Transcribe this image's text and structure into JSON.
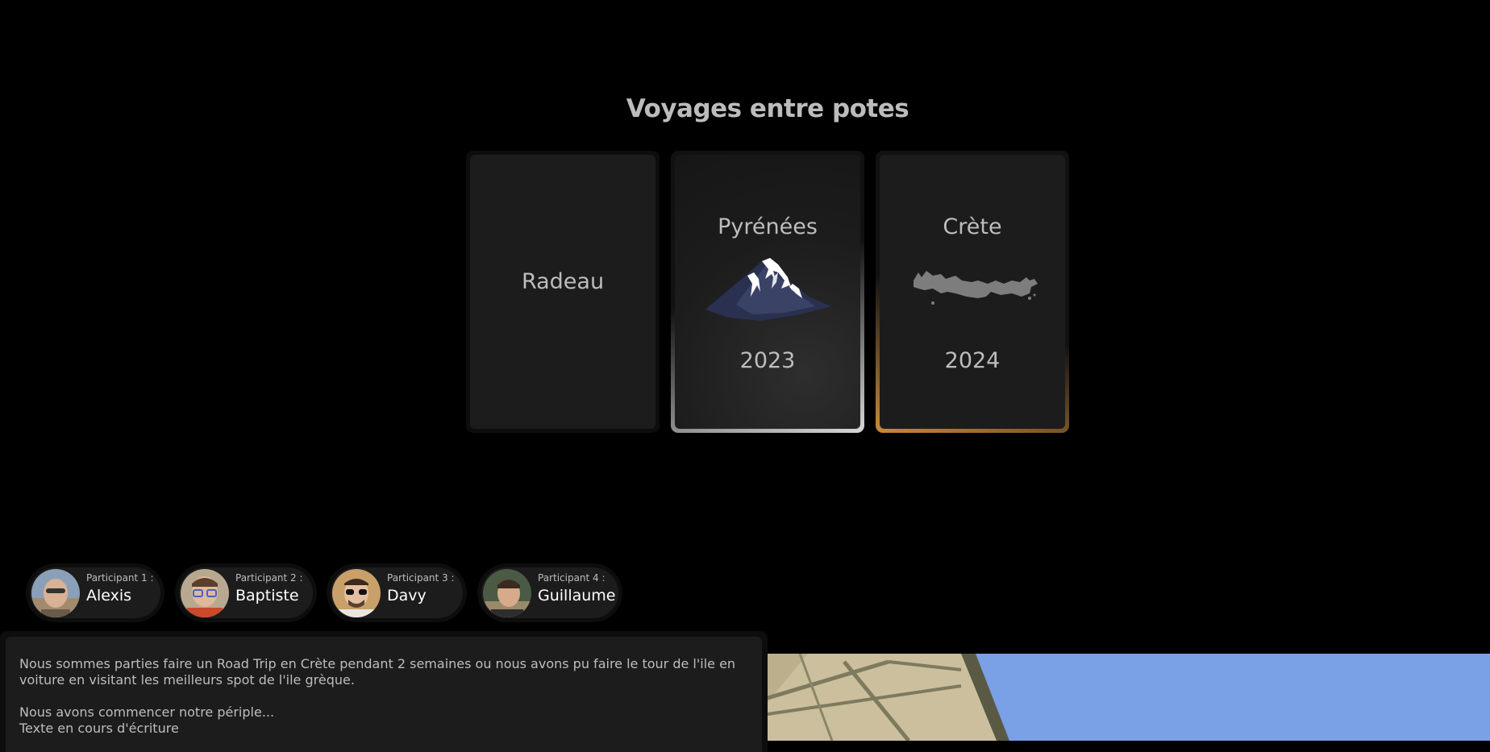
{
  "page": {
    "title": "Voyages entre potes"
  },
  "trips": [
    {
      "name": "Radeau",
      "year": ""
    },
    {
      "name": "Pyrénées",
      "year": "2023",
      "icon": "mountain-icon"
    },
    {
      "name": "Crète",
      "year": "2024",
      "icon": "crete-island-icon"
    }
  ],
  "participants": [
    {
      "label": "Participant 1 :",
      "name": "Alexis"
    },
    {
      "label": "Participant 2 :",
      "name": "Baptiste"
    },
    {
      "label": "Participant 3 :",
      "name": "Davy"
    },
    {
      "label": "Participant 4 :",
      "name": "Guillaume"
    }
  ],
  "story": {
    "paragraph1": "Nous sommes parties faire un Road Trip en Crète pendant 2 semaines ou nous avons pu faire le tour de l'ile en voiture en visitant les meilleurs spot de l'ile grèque.",
    "paragraph2": "Nous avons commencer notre périple...",
    "paragraph3": "Texte en cours d'écriture"
  },
  "colors": {
    "background": "#000000",
    "card": "#1c1c1c",
    "pyrenees_glow": "#d8d8d8",
    "crete_glow": "#c98a3c",
    "sky": "#7aa0e6"
  }
}
